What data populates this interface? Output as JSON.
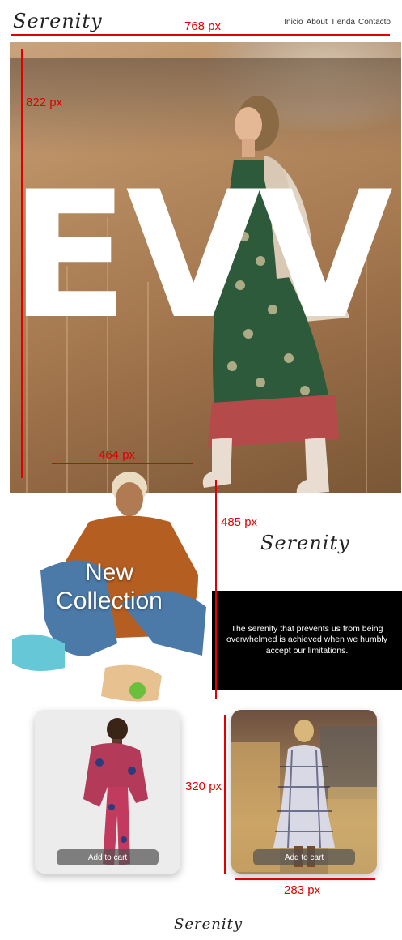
{
  "brand": {
    "logo_text": "Serenity"
  },
  "nav": {
    "items": [
      "Inicio",
      "About",
      "Tienda",
      "Contacto"
    ]
  },
  "hero": {
    "word": "EVVI"
  },
  "collection": {
    "title": "New Collection",
    "quote": "The serenity that prevents us from being overwhelmed is achieved when we humbly accept our limitations."
  },
  "products": [
    {
      "button_label": "Add to cart"
    },
    {
      "button_label": "Add to cart"
    }
  ],
  "annotations": {
    "width_768": "768 px",
    "height_822": "822 px",
    "width_464": "464 px",
    "height_485": "485 px",
    "height_320": "320 px",
    "width_283": "283 px"
  },
  "colors": {
    "accent": "#e00000",
    "quote_bg": "#000000",
    "text": "#111111"
  }
}
